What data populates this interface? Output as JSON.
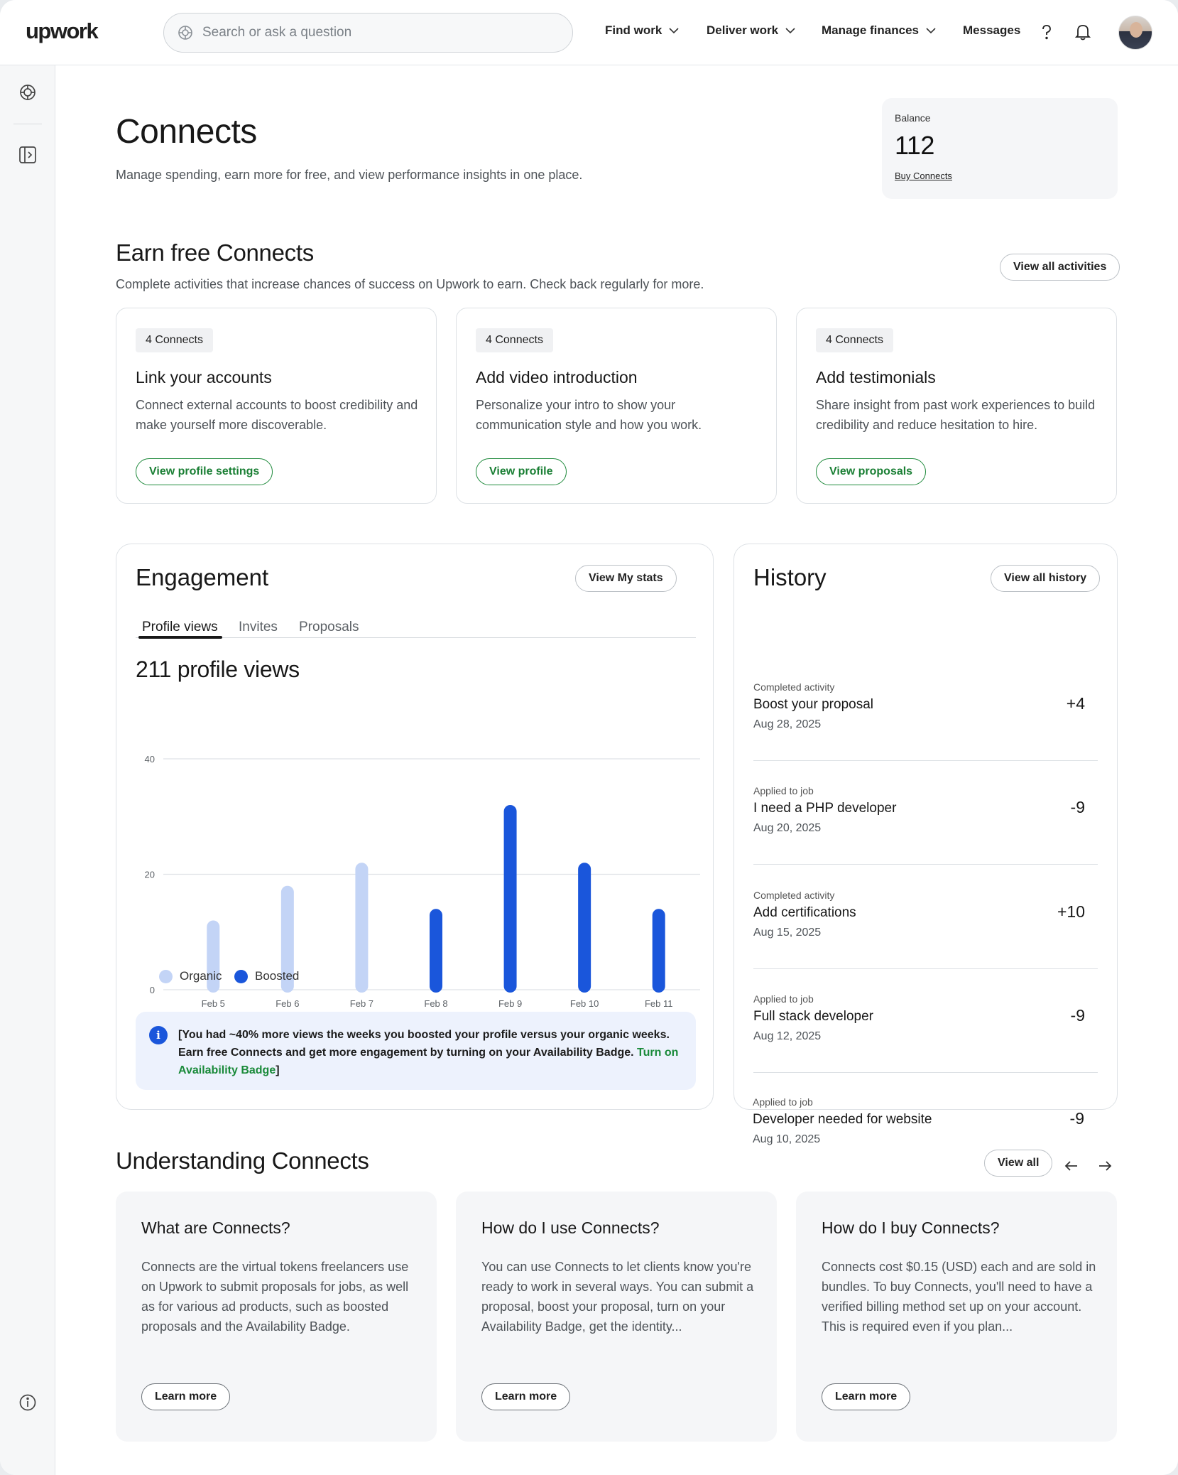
{
  "app": {
    "logo": "upwork"
  },
  "topnav": {
    "search_placeholder": "Search or ask a question",
    "items": [
      {
        "label": "Find work"
      },
      {
        "label": "Deliver work"
      },
      {
        "label": "Manage finances"
      },
      {
        "label": "Messages"
      }
    ],
    "icons": [
      "help-icon",
      "bell-icon",
      "avatar"
    ]
  },
  "rail": {
    "icons": [
      "ai-sparkle-icon",
      "expand-sidebar-icon",
      "info-icon"
    ]
  },
  "header": {
    "title": "Connects",
    "subtitle": "Manage spending, earn more for free, and view performance insights in one place."
  },
  "balance": {
    "label": "Balance",
    "value": "112",
    "link": "Buy Connects"
  },
  "earn": {
    "title": "Earn free Connects",
    "description": "Complete activities that increase chances of success on Upwork to earn. Check back regularly for more.",
    "view_all": "View all activities",
    "cards": [
      {
        "badge": "4 Connects",
        "title": "Link your accounts",
        "description": "Connect external accounts to boost credibility and make yourself more discoverable.",
        "button": "View profile settings"
      },
      {
        "badge": "4 Connects",
        "title": "Add video introduction",
        "description": "Personalize your intro to show your communication style and how you work.",
        "button": "View profile"
      },
      {
        "badge": "4 Connects",
        "title": "Add testimonials",
        "description": "Share insight from past work experiences to build credibility and reduce hesitation to hire.",
        "button": "View proposals"
      }
    ]
  },
  "engagement": {
    "title": "Engagement",
    "stats_button": "View My stats",
    "tabs": [
      "Profile views",
      "Invites",
      "Proposals"
    ],
    "active_tab": "Profile views",
    "headline": "211 profile views",
    "info_text": "[You had ~40% more views the weeks you boosted your profile versus your organic weeks. Earn free Connects and get more engagement by turning on your Availability Badge. ",
    "info_link": "Turn on Availability Badge",
    "info_end": "]"
  },
  "chart_data": {
    "type": "bar",
    "categories": [
      "Feb 5",
      "Feb 6",
      "Feb 7",
      "Feb 8",
      "Feb 9",
      "Feb 10",
      "Feb 11"
    ],
    "values": [
      12,
      18,
      22,
      14,
      32,
      22,
      14
    ],
    "bar_type": [
      "Organic",
      "Organic",
      "Organic",
      "Boosted",
      "Boosted",
      "Boosted",
      "Boosted"
    ],
    "legend": [
      {
        "name": "Organic",
        "color": "#c3d4f6"
      },
      {
        "name": "Boosted",
        "color": "#1a56db"
      }
    ],
    "yticks": [
      0,
      20,
      40
    ],
    "ylim": [
      0,
      40
    ],
    "grid": true,
    "legend_position": "bottom-left"
  },
  "history": {
    "title": "History",
    "view_all": "View all history",
    "items": [
      {
        "kind": "Completed activity",
        "name": "Boost your proposal",
        "date": "Aug 28, 2025",
        "amount": "+4"
      },
      {
        "kind": "Applied to job",
        "name": "I need a PHP developer",
        "date": "Aug 20, 2025",
        "amount": "-9"
      },
      {
        "kind": "Completed activity",
        "name": "Add certifications",
        "date": "Aug 15, 2025",
        "amount": "+10"
      },
      {
        "kind": "Applied to job",
        "name": "Full stack developer",
        "date": "Aug 12, 2025",
        "amount": "-9"
      },
      {
        "kind": "Applied to job",
        "name": "Developer needed for website",
        "date": "Aug 10, 2025",
        "amount": "-9"
      }
    ]
  },
  "understanding": {
    "title": "Understanding Connects",
    "view_all": "View all",
    "cards": [
      {
        "title": "What are Connects?",
        "description": "Connects are the virtual tokens freelancers use on Upwork to submit proposals for jobs, as well as for various ad products, such as boosted proposals and the Availability Badge.",
        "button": "Learn more"
      },
      {
        "title": "How do I use Connects?",
        "description": "You can use Connects to let clients know you're ready to work in several ways. You can submit a proposal, boost your proposal, turn on your Availability Badge, get the identity...",
        "button": "Learn more"
      },
      {
        "title": "How do I buy Connects?",
        "description": "Connects cost $0.15 (USD) each and are sold in bundles. To buy Connects, you'll need to have a verified billing method set up on your account. This is required even if you plan...",
        "button": "Learn more"
      }
    ]
  },
  "colors": {
    "brand_green": "#1a8a3a",
    "boosted": "#1a56db",
    "organic": "#c3d4f6"
  }
}
